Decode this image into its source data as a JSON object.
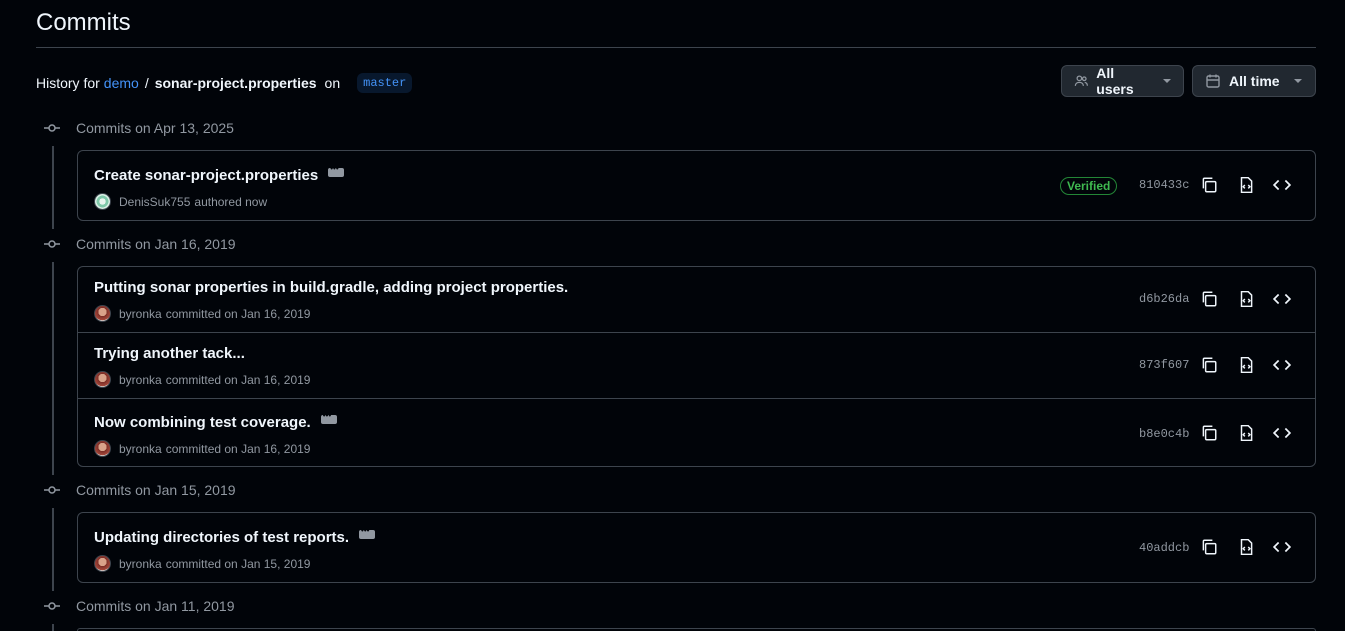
{
  "page": {
    "title": "Commits"
  },
  "history": {
    "prefix": "History for",
    "repo_link": "demo",
    "separator": "/",
    "file": "sonar-project.properties",
    "on": "on",
    "branch": "master"
  },
  "filters": {
    "users_label": "All users",
    "time_label": "All time"
  },
  "icons": {
    "commit": "git-commit-icon",
    "users": "people-icon",
    "calendar": "calendar-icon",
    "copy": "copy-icon",
    "browse": "file-code-icon",
    "code": "code-icon",
    "more": "kebab-horizontal-icon"
  },
  "colors": {
    "background": "#010409",
    "border": "#3d444d",
    "link": "#4493f8",
    "verified": "#3fb950",
    "muted": "#9198a1"
  },
  "groups": [
    {
      "date_label": "Commits on Apr 13, 2025",
      "commits": [
        {
          "message": "Create sonar-project.properties",
          "has_more": true,
          "user": "DenisSuk755",
          "action": "authored now",
          "verified": "Verified",
          "sha": "810433c"
        }
      ]
    },
    {
      "date_label": "Commits on Jan 16, 2019",
      "commits": [
        {
          "message": "Putting sonar properties in build.gradle, adding project properties.",
          "has_more": false,
          "user": "byronka",
          "action": "committed on Jan 16, 2019",
          "sha": "d6b26da"
        },
        {
          "message": "Trying another tack...",
          "has_more": false,
          "user": "byronka",
          "action": "committed on Jan 16, 2019",
          "sha": "873f607"
        },
        {
          "message": "Now combining test coverage.",
          "has_more": true,
          "user": "byronka",
          "action": "committed on Jan 16, 2019",
          "sha": "b8e0c4b"
        }
      ]
    },
    {
      "date_label": "Commits on Jan 15, 2019",
      "commits": [
        {
          "message": "Updating directories of test reports.",
          "has_more": true,
          "user": "byronka",
          "action": "committed on Jan 15, 2019",
          "sha": "40addcb"
        }
      ]
    },
    {
      "date_label": "Commits on Jan 11, 2019",
      "commits": []
    }
  ]
}
